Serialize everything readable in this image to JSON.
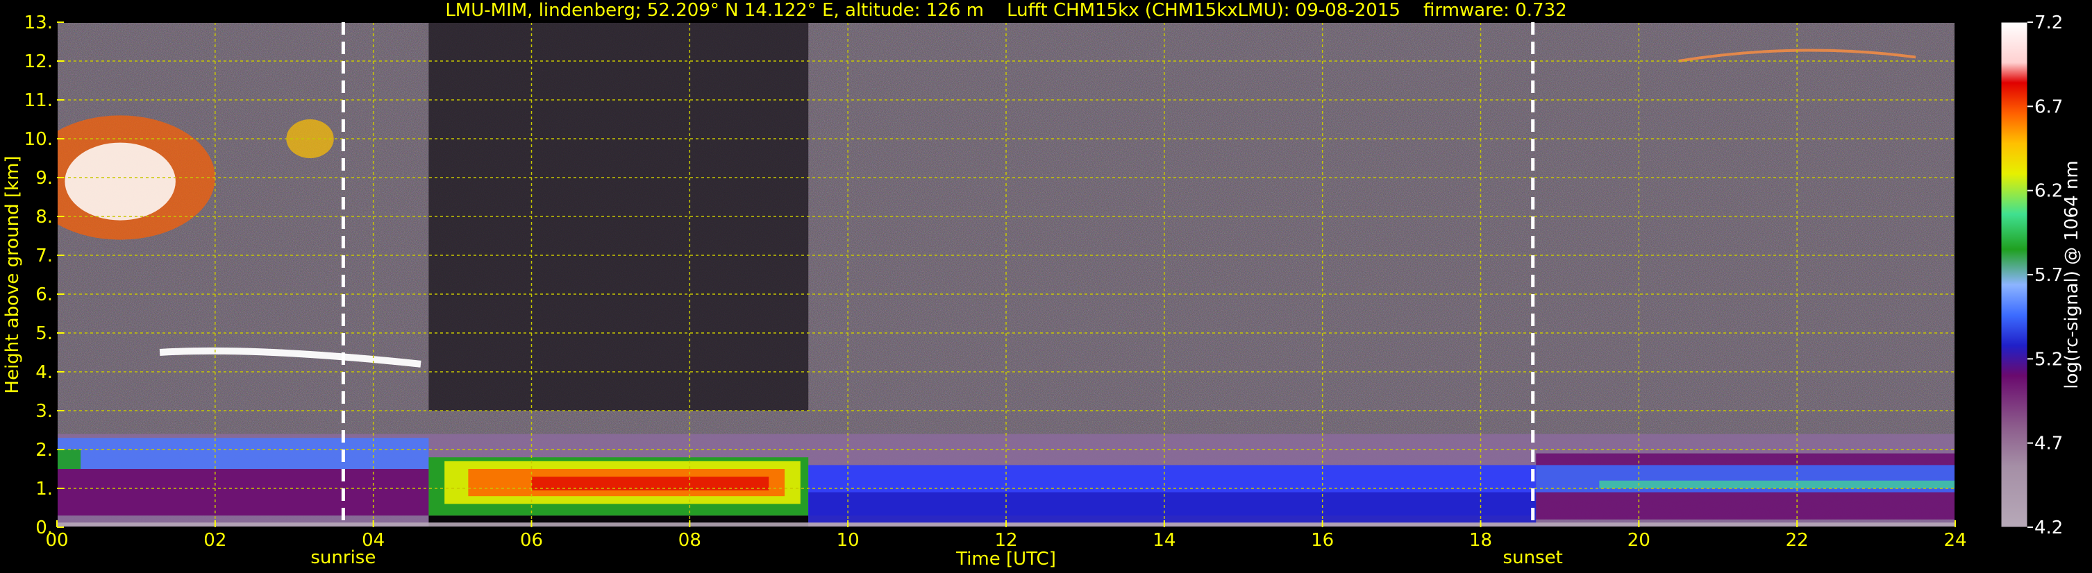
{
  "chart_data": {
    "type": "heatmap",
    "title": "LMU-MIM, lindenberg; 52.209° N 14.122° E, altitude: 126 m    Lufft CHM15kx (CHM15kxLMU): 09-08-2015    firmware: 0.732",
    "xlabel": "Time [UTC]",
    "ylabel": "Height above ground [km]",
    "colorbar_label": "log(rc-signal) @ 1064 nm",
    "xlim": [
      0,
      24
    ],
    "ylim": [
      0,
      13
    ],
    "x_ticks": [
      "00",
      "02",
      "04",
      "06",
      "08",
      "10",
      "12",
      "14",
      "16",
      "18",
      "20",
      "22",
      "24"
    ],
    "y_ticks": [
      "0.",
      "1.",
      "2.",
      "3.",
      "4.",
      "5.",
      "6.",
      "7.",
      "8.",
      "9.",
      "10.",
      "11.",
      "12.",
      "13."
    ],
    "colorbar_range": [
      4.2,
      7.2
    ],
    "colorbar_ticks": [
      "4.2",
      "4.7",
      "5.2",
      "5.7",
      "6.2",
      "6.7",
      "7.2"
    ],
    "grid": true,
    "markers": [
      {
        "label": "sunrise",
        "time": 3.62
      },
      {
        "label": "sunset",
        "time": 18.66
      }
    ],
    "colors": {
      "axis_text": "#ffff00",
      "grid": "#c8c800",
      "marker_line": "#ffffff",
      "background_noise": "#5a4c5e"
    }
  }
}
